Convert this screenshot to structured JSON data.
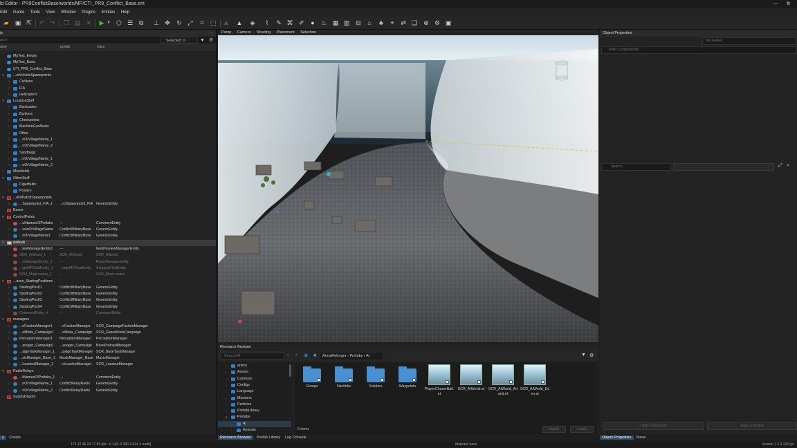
{
  "titlebar": {
    "title": "ld Editor - PR9ConflictBase/worlds/MP/CTI_PR9_Conflict_Base.ent",
    "min": "—",
    "max": "⧉"
  },
  "menu": [
    "Edit",
    "Game",
    "Tools",
    "View",
    "Window",
    "Plugins",
    "Entities",
    "Help"
  ],
  "left_panel": {
    "title": "ty",
    "search_placeholder": "arch",
    "selected": "Selected: 0",
    "columns": [
      "ame",
      "prefab",
      "class"
    ],
    "rows": [
      {
        "d": 0,
        "tw": "",
        "ic": "world",
        "name": "MpTest_Empty",
        "c2": "",
        "c3": ""
      },
      {
        "d": 0,
        "tw": "",
        "ic": "world",
        "name": "MpTest_Basic",
        "c2": "",
        "c3": ""
      },
      {
        "d": 0,
        "tw": "",
        "ic": "world",
        "name": "CTI_PR9_Conflict_Base",
        "c2": "",
        "c3": ""
      },
      {
        "d": 0,
        "tw": "▾",
        "ic": "folder",
        "name": "...ntVehicleSpawnpoints",
        "c2": "",
        "c3": ""
      },
      {
        "d": 1,
        "tw": "›",
        "ic": "folder",
        "name": "Civilians",
        "c2": "",
        "c3": ""
      },
      {
        "d": 1,
        "tw": "›",
        "ic": "folder",
        "name": "FIA",
        "c2": "",
        "c3": ""
      },
      {
        "d": 1,
        "tw": "›",
        "ic": "folder",
        "name": "Helicopters",
        "c2": "",
        "c3": ""
      },
      {
        "d": 0,
        "tw": "▾",
        "ic": "folder",
        "name": "LocationStuff",
        "c2": "",
        "c3": ""
      },
      {
        "d": 1,
        "tw": "›",
        "ic": "folder",
        "name": "Barricades",
        "c2": "",
        "c3": ""
      },
      {
        "d": 1,
        "tw": "›",
        "ic": "folder",
        "name": "Bunkers",
        "c2": "",
        "c3": ""
      },
      {
        "d": 1,
        "tw": "›",
        "ic": "folder",
        "name": "Checkpoints",
        "c2": "",
        "c3": ""
      },
      {
        "d": 1,
        "tw": "›",
        "ic": "folder",
        "name": "MachineGunNests",
        "c2": "",
        "c3": ""
      },
      {
        "d": 1,
        "tw": "›",
        "ic": "folder",
        "name": "Other",
        "c2": "",
        "c3": ""
      },
      {
        "d": 1,
        "tw": "›",
        "ic": "folder",
        "name": "...nOrVillageName_1",
        "c2": "",
        "c3": ""
      },
      {
        "d": 1,
        "tw": "›",
        "ic": "folder",
        "name": "...nOrVillageName_2",
        "c2": "",
        "c3": ""
      },
      {
        "d": 1,
        "tw": "›",
        "ic": "folder",
        "name": "Sandbags",
        "c2": "",
        "c3": ""
      },
      {
        "d": 1,
        "tw": "›",
        "ic": "folder",
        "name": "...nOrVillageName_1",
        "c2": "",
        "c3": ""
      },
      {
        "d": 1,
        "tw": "›",
        "ic": "folder",
        "name": "...nOrVillageName_2",
        "c2": "",
        "c3": ""
      },
      {
        "d": 0,
        "tw": "›",
        "ic": "folder",
        "name": "Minefields",
        "c2": "",
        "c3": ""
      },
      {
        "d": 0,
        "tw": "▾",
        "ic": "folder",
        "name": "OtherStuff",
        "c2": "",
        "c3": ""
      },
      {
        "d": 1,
        "tw": "›",
        "ic": "folder",
        "name": "CigarButts",
        "c2": "",
        "c3": ""
      },
      {
        "d": 1,
        "tw": "›",
        "ic": "folder",
        "name": "Posters",
        "c2": "",
        "c3": ""
      },
      {
        "d": 0,
        "tw": "▾",
        "ic": "box",
        "name": "...ientPatrolSpawnpoints",
        "c2": "",
        "c3": ""
      },
      {
        "d": 1,
        "tw": "›",
        "ic": "comp",
        "name": "...Spawnpoint_FIA_1",
        "c2": "...rolSpawnpoint_FIA",
        "c3": "GenericEntity"
      },
      {
        "d": 0,
        "tw": "",
        "ic": "box",
        "name": "Bases",
        "c2": "",
        "c3": ""
      },
      {
        "d": 0,
        "tw": "▾",
        "ic": "box",
        "name": "ControlPoints",
        "c2": "",
        "c3": ""
      },
      {
        "d": 1,
        "tw": "",
        "ic": "ent",
        "name": "...utNamesOfPrefabs",
        "c2": "---",
        "c3": "CommentEntity"
      },
      {
        "d": 1,
        "tw": "›",
        "ic": "comp",
        "name": "...ownOrVillageName",
        "c2": "ConflictMilitaryBase",
        "c3": "GenericEntity"
      },
      {
        "d": 1,
        "tw": "›",
        "ic": "comp",
        "name": "...nOrVillageName1",
        "c2": "ConflictMilitaryBase",
        "c3": "GenericEntity"
      },
      {
        "d": 0,
        "tw": "▾",
        "ic": "layer",
        "name": "default",
        "c2": "",
        "c3": "",
        "sel": true
      },
      {
        "d": 1,
        "tw": "",
        "ic": "ent",
        "name": "...iewManagerEntity1",
        "c2": "---",
        "c3": "ItemPreviewManagerEntity"
      },
      {
        "d": 1,
        "tw": "›",
        "ic": "entdim",
        "name": "SCR_AIWorld_1",
        "c2": "SCR_AIWorld",
        "c3": "SCR_AIWorld",
        "dim": true
      },
      {
        "d": 1,
        "tw": "",
        "ic": "entdim",
        "name": "...ioManagerEntity_1",
        "c2": "---",
        "c3": "RadioManagerEntity",
        "dim": true
      },
      {
        "d": 1,
        "tw": "",
        "ic": "entdim",
        "name": "...ignMPChatEntity_1",
        "c2": "...aignMPChatEntity",
        "c3": "ScriptedChatEntity",
        "dim": true
      },
      {
        "d": 1,
        "tw": "",
        "ic": "entdim",
        "name": "SCR_MapLocator_1",
        "c2": "---",
        "c3": "SCR_MapLocator",
        "dim": true
      },
      {
        "d": 0,
        "tw": "▾",
        "ic": "box",
        "name": "...ases_StartingPositions",
        "c2": "",
        "c3": ""
      },
      {
        "d": 1,
        "tw": "›",
        "ic": "comp",
        "name": "StartingPos01",
        "c2": "ConflictMilitaryBase",
        "c3": "GenericEntity"
      },
      {
        "d": 1,
        "tw": "›",
        "ic": "comp",
        "name": "StartingPos02",
        "c2": "ConflictMilitaryBase",
        "c3": "GenericEntity"
      },
      {
        "d": 1,
        "tw": "›",
        "ic": "comp",
        "name": "StartingPos03",
        "c2": "ConflictMilitaryBase",
        "c3": "GenericEntity"
      },
      {
        "d": 1,
        "tw": "›",
        "ic": "comp",
        "name": "StartingPos04",
        "c2": "ConflictMilitaryBase",
        "c3": "GenericEntity"
      },
      {
        "d": 1,
        "tw": "",
        "ic": "entdim",
        "name": "CommentEntity_4",
        "c2": "---",
        "c3": "CommentEntity",
        "dim": true
      },
      {
        "d": 0,
        "tw": "▾",
        "ic": "box",
        "name": "managers",
        "c2": "",
        "c3": ""
      },
      {
        "d": 1,
        "tw": "›",
        "ic": "comp",
        "name": "...nFactionManager1",
        "c2": "...nFactionManager",
        "c3": "SCR_CampaignFactionManager"
      },
      {
        "d": 1,
        "tw": "›",
        "ic": "comp",
        "name": "...eMode_Campaign1",
        "c2": "...eMode_Campaign",
        "c3": "SCR_GameModeCampaign"
      },
      {
        "d": 1,
        "tw": "›",
        "ic": "comp",
        "name": "PerceptionManager1",
        "c2": "PerceptionManager",
        "c3": "PerceptionManager"
      },
      {
        "d": 1,
        "tw": "›",
        "ic": "comp",
        "name": "...anager_Campaign1",
        "c2": "...anager_Campaign",
        "c3": "BasePreloadManager"
      },
      {
        "d": 1,
        "tw": "›",
        "ic": "comp",
        "name": "...aignTaskManager_1",
        "c2": "...paignTaskManager",
        "c3": "SCR_BaseTaskManager"
      },
      {
        "d": 1,
        "tw": "›",
        "ic": "comp",
        "name": "...sicManager_Base_1",
        "c2": "MusicManager_Base",
        "c3": "MusicManager"
      },
      {
        "d": 1,
        "tw": "›",
        "ic": "comp",
        "name": "...LoadoutManager_1",
        "c2": "...nLoadoutManager",
        "c3": "SCR_LoadoutManager"
      },
      {
        "d": 0,
        "tw": "▾",
        "ic": "box",
        "name": "RadioRelays",
        "c2": "",
        "c3": ""
      },
      {
        "d": 1,
        "tw": "",
        "ic": "ent",
        "name": "...tNamesOfPrefabs_1",
        "c2": "---",
        "c3": "CommentEntity"
      },
      {
        "d": 1,
        "tw": "›",
        "ic": "comp",
        "name": "...nOrVillageName_1",
        "c2": "ConflictRelayRadio",
        "c3": "GenericEntity"
      },
      {
        "d": 1,
        "tw": "›",
        "ic": "comp",
        "name": "...nOrVillageName_2",
        "c2": "ConflictRelayRadio",
        "c3": "GenericEntity"
      },
      {
        "d": 0,
        "tw": "›",
        "ic": "box",
        "name": "SupplyDepots",
        "c2": "",
        "c3": ""
      }
    ],
    "bottom_tabs": [
      "y",
      "Create"
    ]
  },
  "viewport": {
    "tabs": [
      "Persp",
      "Camera",
      "Shading",
      "Placement",
      "Selection"
    ]
  },
  "resource_browser": {
    "title": "Resource Browser",
    "search_placeholder": "Search AI",
    "breadcrumb": [
      "ArmaReforger",
      "Prefabs",
      "AI"
    ],
    "tree": [
      {
        "d": 0,
        "tw": "›",
        "name": "anims"
      },
      {
        "d": 0,
        "tw": "›",
        "name": "Assets"
      },
      {
        "d": 0,
        "tw": "›",
        "name": "Common"
      },
      {
        "d": 0,
        "tw": "›",
        "name": "Configs"
      },
      {
        "d": 0,
        "tw": "",
        "name": "Language"
      },
      {
        "d": 0,
        "tw": "›",
        "name": "Missions"
      },
      {
        "d": 0,
        "tw": "›",
        "name": "Particles"
      },
      {
        "d": 0,
        "tw": "›",
        "name": "PrefabLibrary"
      },
      {
        "d": 0,
        "tw": "▾",
        "name": "Prefabs"
      },
      {
        "d": 1,
        "tw": "›",
        "name": "AI",
        "sel": true
      },
      {
        "d": 1,
        "tw": "›",
        "name": "Animals"
      }
    ],
    "items": [
      {
        "type": "folder",
        "label": "Groups"
      },
      {
        "type": "folder",
        "label": "Navlinks"
      },
      {
        "type": "folder",
        "label": "Soldiers"
      },
      {
        "type": "folder",
        "label": "Waypoints"
      },
      {
        "type": "prefab",
        "label": "PlayerChaserBall.et"
      },
      {
        "type": "prefab",
        "label": "SCR_AIWorld.et"
      },
      {
        "type": "prefab",
        "label": "SCR_AIWorld_Arland.et"
      },
      {
        "type": "prefab",
        "label": "SCR_AIWorld_Eden.et"
      }
    ],
    "item_count": "0 items",
    "import_label": "Import",
    "locate_label": "Locate",
    "bottom_tabs": [
      "Resource Browser",
      "Prefab Library",
      "Log Console"
    ]
  },
  "object_properties": {
    "title": "Object Properties",
    "filter_placeholder": "Filter Components",
    "name_placeholder": "(no name)",
    "search_placeholder": "Search",
    "add_component": "+ Add Component",
    "apply_prefab": "Apply to prefab",
    "bottom_tabs": [
      "Object Properties",
      "Move"
    ]
  },
  "status": {
    "coords": "173.22      46.24      77.99 [dir: -0.143 -0.356  0.924 = north]",
    "material": "Material: none",
    "version": "Version 1.2.0.124 (pr"
  },
  "colors": {
    "accent": "#2f80c8",
    "entity": "#d74848",
    "selection": "#2e4a66"
  }
}
